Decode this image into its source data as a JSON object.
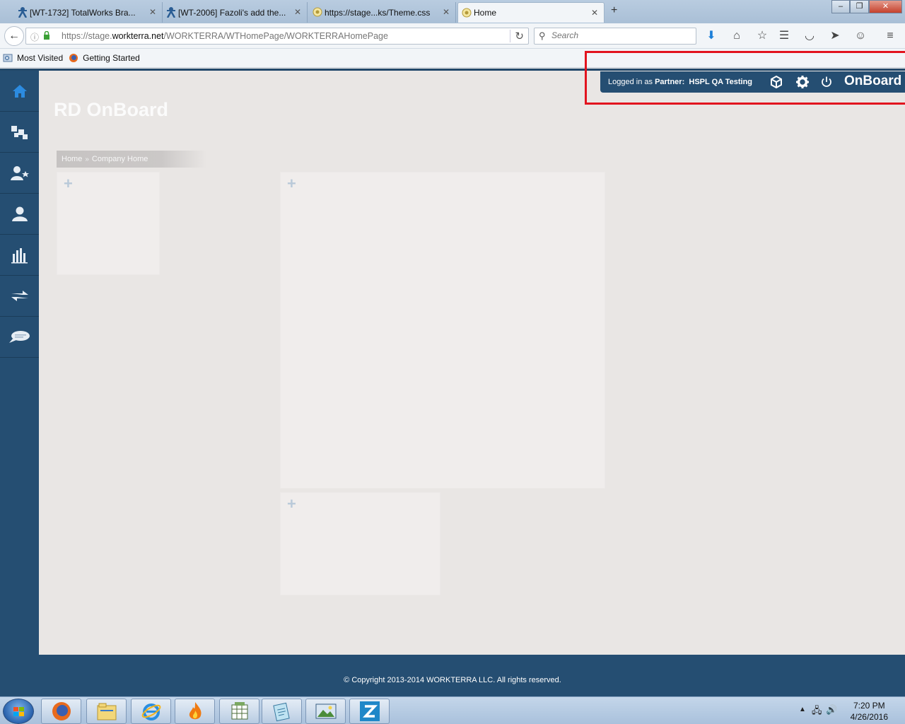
{
  "browser": {
    "tabs": [
      {
        "title": "[WT-1732] TotalWorks Bra...",
        "icon": "jira-icon"
      },
      {
        "title": "[WT-2006] Fazoli's add the...",
        "icon": "jira-icon"
      },
      {
        "title": "https://stage...ks/Theme.css",
        "icon": "page-icon"
      },
      {
        "title": "Home",
        "icon": "page-icon"
      }
    ],
    "new_tab": "+",
    "url_prefix": "https://stage.",
    "url_domain": "workterra.net",
    "url_path": "/WORKTERRA/WTHomePage/WORKTERRAHomePage",
    "search_placeholder": "Search",
    "bookmarks": [
      "Most Visited",
      "Getting Started"
    ]
  },
  "app": {
    "title": "RD OnBoard",
    "breadcrumb": {
      "home": "Home",
      "separator": "»",
      "current": "Company Home"
    },
    "topbar": {
      "logged_prefix": "Logged in as",
      "role": "Partner:",
      "user": "HSPL QA Testing",
      "brand": "OnBoard"
    },
    "sidebar": [
      {
        "icon": "home-icon"
      },
      {
        "icon": "puzzle-icon"
      },
      {
        "icon": "user-star-icon"
      },
      {
        "icon": "user-icon"
      },
      {
        "icon": "bar-chart-icon"
      },
      {
        "icon": "transfer-arrows-icon"
      },
      {
        "icon": "chat-bubble-icon"
      }
    ],
    "panel_add_symbol": "+",
    "footer": "© Copyright 2013-2014 WORKTERRA LLC. All rights reserved."
  },
  "taskbar": {
    "time": "7:20 PM",
    "date": "4/26/2016",
    "apps": [
      "firefox-icon",
      "explorer-icon",
      "ie-icon",
      "flame-app-icon",
      "spreadsheet-icon",
      "notepad-icon",
      "picture-viewer-icon",
      "z-app-icon"
    ]
  }
}
